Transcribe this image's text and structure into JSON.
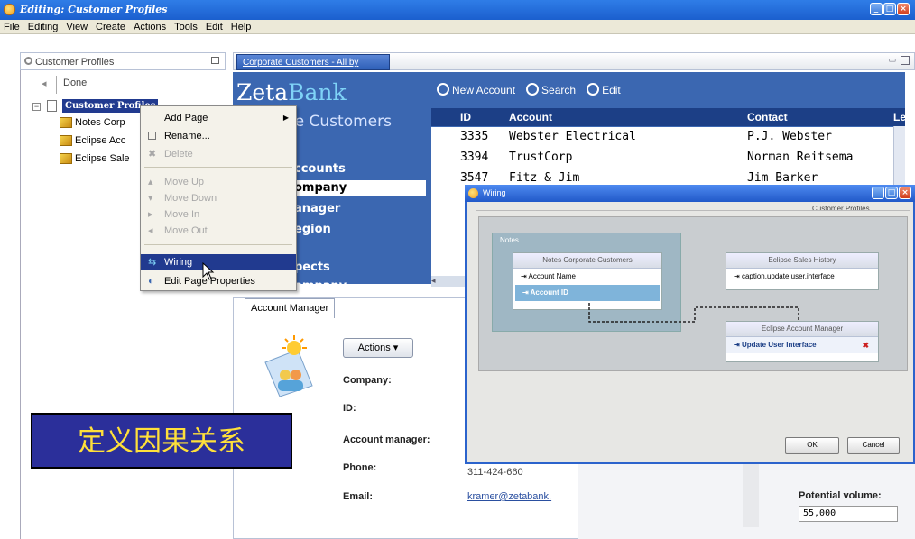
{
  "window": {
    "title": "Editing: Customer Profiles"
  },
  "menu": [
    "File",
    "Editing",
    "View",
    "Create",
    "Actions",
    "Tools",
    "Edit",
    "Help"
  ],
  "left_panel": {
    "title": "Customer Profiles",
    "done_label": "Done",
    "tree_root": "Customer Profiles",
    "tree_items": [
      "Notes Corp",
      "Eclipse Acc",
      "Eclipse Sale"
    ]
  },
  "context_menu": {
    "items": [
      {
        "label": "Add Page",
        "enabled": true
      },
      {
        "label": "Rename...",
        "enabled": true
      },
      {
        "label": "Delete",
        "enabled": false
      },
      {
        "label": "Move Up",
        "enabled": false
      },
      {
        "label": "Move Down",
        "enabled": false
      },
      {
        "label": "Move In",
        "enabled": false
      },
      {
        "label": "Move Out",
        "enabled": false
      },
      {
        "label": "Wiring",
        "enabled": true,
        "selected": true
      },
      {
        "label": "Edit Page Properties",
        "enabled": true
      }
    ]
  },
  "main": {
    "tab_label": "Corporate Customers - All by",
    "logo_zeta": "Zeta",
    "logo_bank": "Bank",
    "subtitle": "te Customers",
    "nav": [
      "ccounts",
      "ompany",
      "anager",
      "egion",
      "pects",
      "ompany"
    ],
    "toolbar": {
      "new_account": "New Account",
      "search": "Search",
      "edit": "Edit"
    },
    "table": {
      "columns": [
        "ID",
        "Account",
        "Contact",
        "Le"
      ],
      "rows": [
        [
          "3335",
          "Webster Electrical",
          "P.J. Webster"
        ],
        [
          "3394",
          "TrustCorp",
          "Norman Reitsema"
        ],
        [
          "3547",
          "Fitz & Jim",
          "Jim Barker"
        ]
      ]
    }
  },
  "detail": {
    "tab": "Account Manager",
    "actions_label": "Actions",
    "fields": {
      "company": "Company:",
      "id": "ID:",
      "account_manager": "Account manager:",
      "phone": "Phone:",
      "email": "Email:"
    },
    "phone_value": "311-424-660",
    "email_value": "kramer@zetabank.",
    "potential_volume_label": "Potential volume:",
    "potential_volume_value": "55,000"
  },
  "banner": {
    "text": "定义因果关系"
  },
  "wiring_dialog": {
    "title": "Wiring",
    "header_label": "Customer Profiles",
    "group_label": "Notes",
    "source_box": {
      "title": "Notes Corporate Customers",
      "items": [
        "Account Name",
        "Account ID"
      ]
    },
    "history_box": {
      "title": "Eclipse Sales History",
      "items": [
        "caption.update.user.interface"
      ]
    },
    "target_box": {
      "title": "Eclipse Account Manager",
      "items": [
        "Update User Interface"
      ]
    },
    "ok_label": "OK",
    "cancel_label": "Cancel"
  },
  "colors": {
    "accent": "#3b67b1",
    "header_blue": "#1c3f86",
    "banner_text": "#ffe03a",
    "banner_bg": "#2b2f9a"
  }
}
